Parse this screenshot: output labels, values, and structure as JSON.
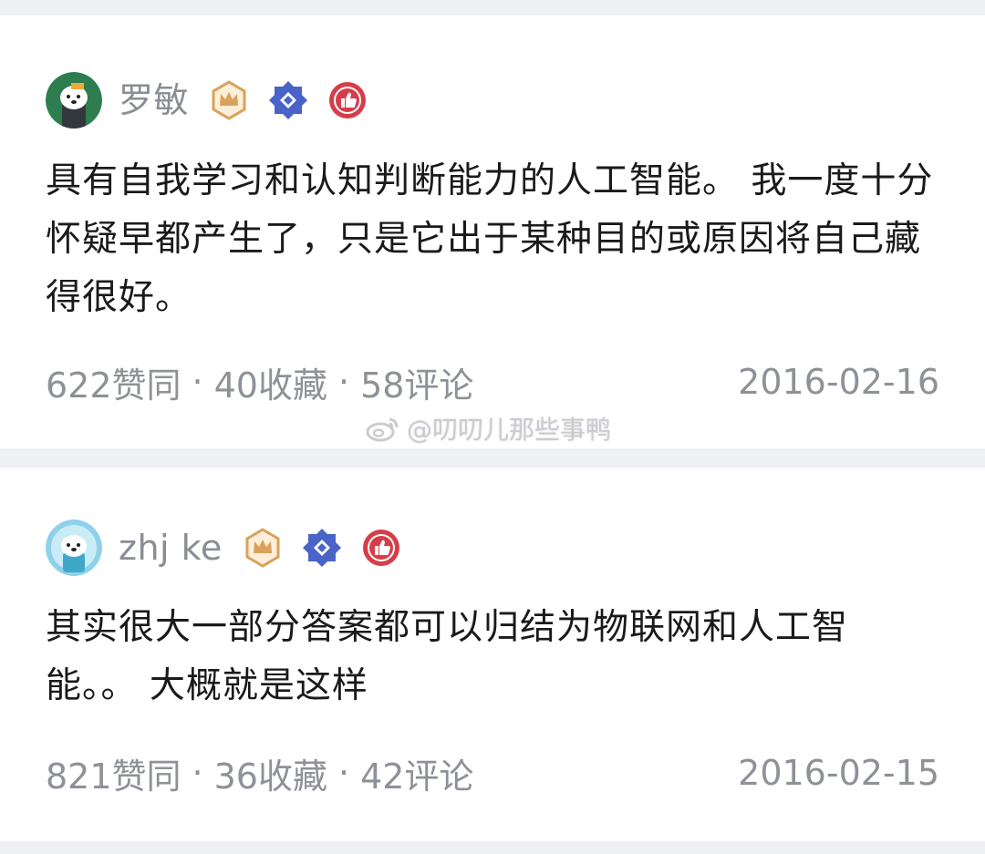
{
  "answers": [
    {
      "author": "罗敏",
      "avatar": "dog-avatar-green",
      "badges": [
        "crown-badge-icon",
        "diamond-badge-icon",
        "thumbs-up-badge-icon"
      ],
      "text": "具有自我学习和认知判断能力的人工智能。 我一度十分怀疑早都产生了，只是它出于某种目的或原因将自己藏得很好。",
      "stats": {
        "likes": "622赞同",
        "favorites": "40收藏",
        "comments": "58评论"
      },
      "date": "2016-02-16"
    },
    {
      "author": "zhj ke",
      "avatar": "dog-avatar-blue",
      "badges": [
        "crown-badge-icon",
        "diamond-badge-icon",
        "thumbs-up-badge-icon"
      ],
      "text": "其实很大一部分答案都可以归结为物联网和人工智能。。 大概就是这样",
      "stats": {
        "likes": "821赞同",
        "favorites": "36收藏",
        "comments": "42评论"
      },
      "date": "2016-02-15"
    }
  ],
  "meta_separator": "·",
  "watermark": "@叨叨儿那些事鸭",
  "colors": {
    "background": "#eef0f3",
    "card": "#ffffff",
    "text_primary": "#1a1a1a",
    "text_secondary": "#8e9197",
    "crown_badge": "#d9a25b",
    "diamond_badge": "#4a63c8",
    "thumbs_badge": "#d63d4a"
  }
}
